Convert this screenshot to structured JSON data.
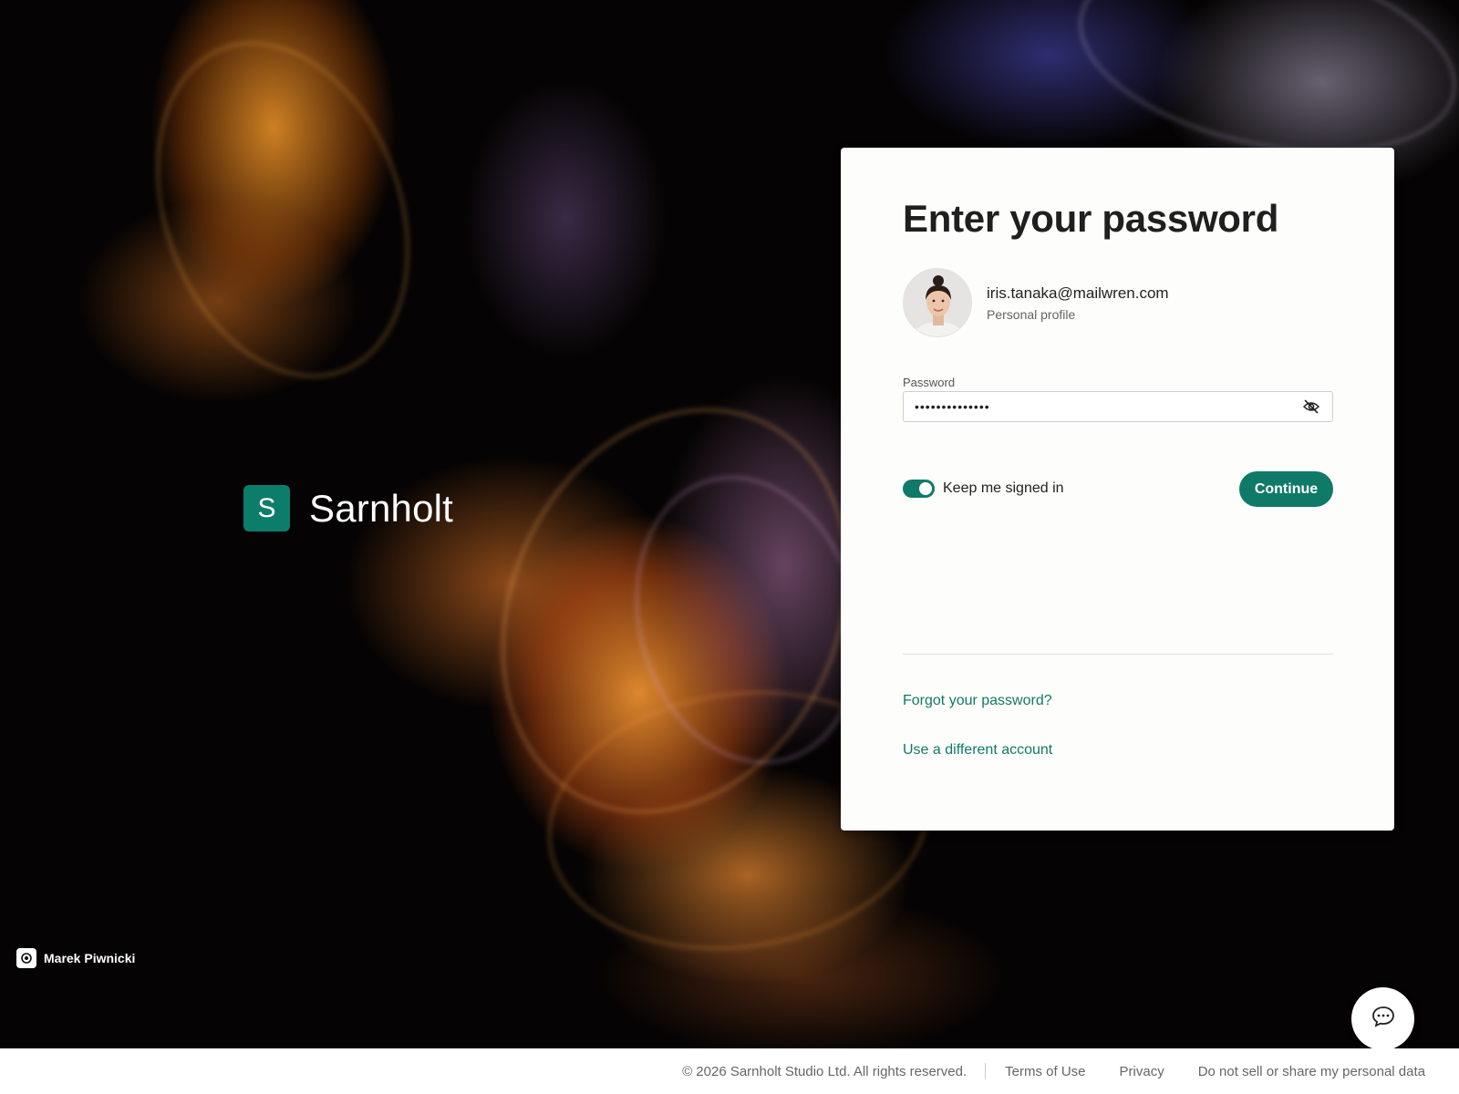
{
  "brand": {
    "logo_letter": "S",
    "name": "Sarnholt",
    "accent_color": "#107a68"
  },
  "photo_credit": {
    "icon": "camera-icon",
    "name": "Marek Piwnicki"
  },
  "signin": {
    "title": "Enter your password",
    "account": {
      "email": "iris.tanaka@mailwren.com",
      "profile_type": "Personal profile"
    },
    "password": {
      "label": "Password",
      "value": "••••••••••••••",
      "visibility_icon": "eye-off-icon"
    },
    "keep_signed_in": {
      "label": "Keep me signed in",
      "checked": true
    },
    "continue_label": "Continue",
    "forgot_link": "Forgot your password?",
    "different_account_link": "Use a different account"
  },
  "chat": {
    "icon": "chat-bubble-icon"
  },
  "footer": {
    "copyright": "© 2026 Sarnholt Studio Ltd. All rights reserved.",
    "links": [
      "Terms of Use",
      "Privacy",
      "Do not sell or share my personal data"
    ]
  }
}
